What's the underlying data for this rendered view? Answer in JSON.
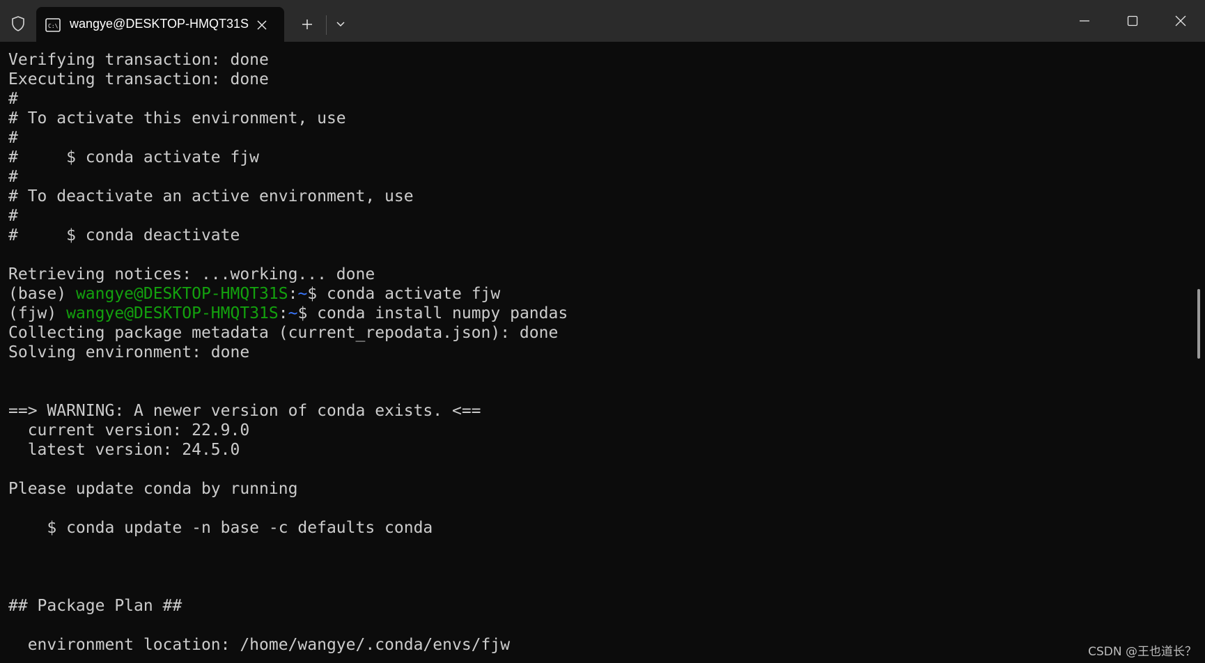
{
  "window": {
    "tab_title": "wangye@DESKTOP-HMQT31S",
    "icons": {
      "shield": "shield-icon",
      "tab": "terminal-icon",
      "tab_close": "close-icon",
      "new_tab": "plus-icon",
      "dropdown": "chevron-down-icon",
      "minimize": "minimize-icon",
      "maximize": "maximize-icon",
      "close": "close-icon"
    }
  },
  "colors": {
    "background": "#0c0c0c",
    "titlebar": "#2b2b2b",
    "text": "#cccccc",
    "prompt_user": "#13a10e",
    "prompt_path": "#3b78ff"
  },
  "terminal": {
    "lines": [
      [
        {
          "text": "Verifying transaction: done"
        }
      ],
      [
        {
          "text": "Executing transaction: done"
        }
      ],
      [
        {
          "text": "#"
        }
      ],
      [
        {
          "text": "# To activate this environment, use"
        }
      ],
      [
        {
          "text": "#"
        }
      ],
      [
        {
          "text": "#     $ conda activate fjw"
        }
      ],
      [
        {
          "text": "#"
        }
      ],
      [
        {
          "text": "# To deactivate an active environment, use"
        }
      ],
      [
        {
          "text": "#"
        }
      ],
      [
        {
          "text": "#     $ conda deactivate"
        }
      ],
      [
        {
          "text": ""
        }
      ],
      [
        {
          "text": "Retrieving notices: ...working... done"
        }
      ],
      [
        {
          "text": "(base) "
        },
        {
          "text": "wangye@DESKTOP-HMQT31S",
          "style": "user"
        },
        {
          "text": ":"
        },
        {
          "text": "~",
          "style": "path"
        },
        {
          "text": "$ conda activate fjw"
        }
      ],
      [
        {
          "text": "(fjw) "
        },
        {
          "text": "wangye@DESKTOP-HMQT31S",
          "style": "user"
        },
        {
          "text": ":"
        },
        {
          "text": "~",
          "style": "path"
        },
        {
          "text": "$ conda install numpy pandas"
        }
      ],
      [
        {
          "text": "Collecting package metadata (current_repodata.json): done"
        }
      ],
      [
        {
          "text": "Solving environment: done"
        }
      ],
      [
        {
          "text": ""
        }
      ],
      [
        {
          "text": ""
        }
      ],
      [
        {
          "text": "==> WARNING: A newer version of conda exists. <=="
        }
      ],
      [
        {
          "text": "  current version: 22.9.0"
        }
      ],
      [
        {
          "text": "  latest version: 24.5.0"
        }
      ],
      [
        {
          "text": ""
        }
      ],
      [
        {
          "text": "Please update conda by running"
        }
      ],
      [
        {
          "text": ""
        }
      ],
      [
        {
          "text": "    $ conda update -n base -c defaults conda"
        }
      ],
      [
        {
          "text": ""
        }
      ],
      [
        {
          "text": ""
        }
      ],
      [
        {
          "text": ""
        }
      ],
      [
        {
          "text": "## Package Plan ##"
        }
      ],
      [
        {
          "text": ""
        }
      ],
      [
        {
          "text": "  environment location: /home/wangye/.conda/envs/fjw"
        }
      ]
    ]
  },
  "watermark": "CSDN @王也道长？"
}
